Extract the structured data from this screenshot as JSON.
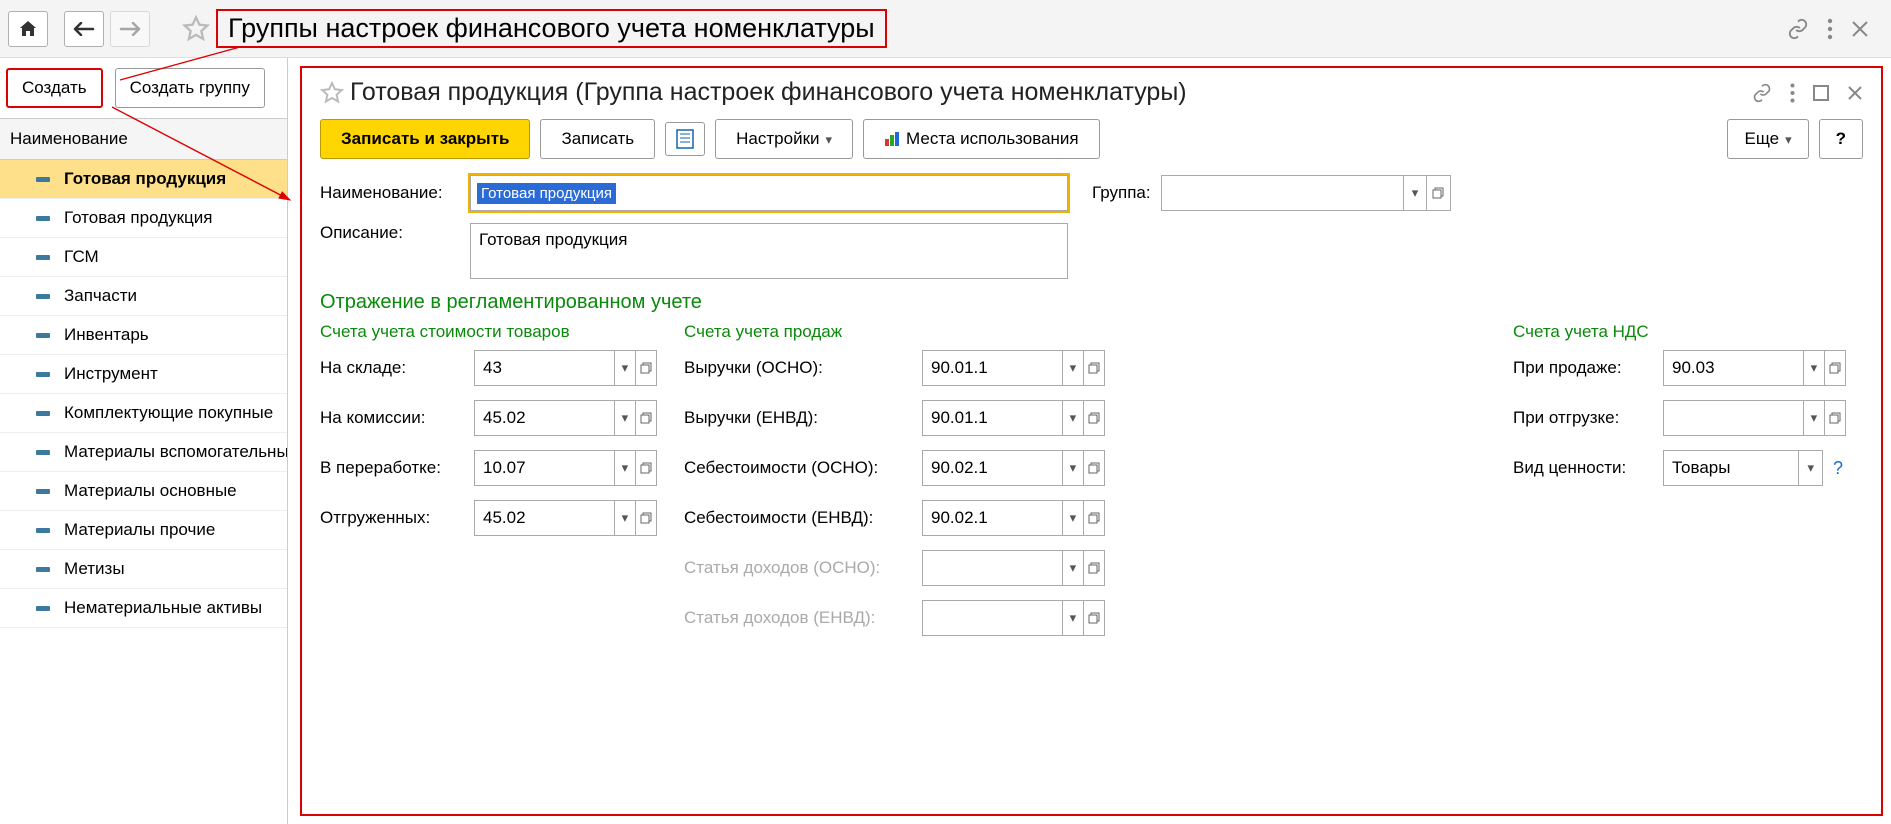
{
  "page": {
    "title": "Группы настроек финансового учета номенклатуры"
  },
  "left": {
    "create": "Создать",
    "createGroup": "Создать группу",
    "header": "Наименование",
    "items": [
      {
        "label": "Готовая продукция",
        "selected": true
      },
      {
        "label": "Готовая продукция"
      },
      {
        "label": "ГСМ"
      },
      {
        "label": "Запчасти"
      },
      {
        "label": "Инвентарь"
      },
      {
        "label": "Инструмент"
      },
      {
        "label": "Комплектующие покупные"
      },
      {
        "label": "Материалы вспомогательные"
      },
      {
        "label": "Материалы основные"
      },
      {
        "label": "Материалы прочие"
      },
      {
        "label": "Метизы"
      },
      {
        "label": "Нематериальные активы"
      }
    ]
  },
  "form": {
    "title": "Готовая продукция (Группа настроек финансового учета номенклатуры)",
    "toolbar": {
      "saveClose": "Записать и закрыть",
      "save": "Записать",
      "settings": "Настройки",
      "usages": "Места использования",
      "more": "Еще",
      "help": "?"
    },
    "fields": {
      "nameLabel": "Наименование:",
      "nameValue": "Готовая продукция",
      "groupLabel": "Группа:",
      "groupValue": "",
      "descLabel": "Описание:",
      "descValue": "Готовая продукция"
    },
    "section": "Отражение в регламентированном учете",
    "col1": {
      "header": "Счета учета стоимости товаров",
      "rows": [
        {
          "label": "На складе:",
          "value": "43"
        },
        {
          "label": "На комиссии:",
          "value": "45.02"
        },
        {
          "label": "В переработке:",
          "value": "10.07"
        },
        {
          "label": "Отгруженных:",
          "value": "45.02"
        }
      ]
    },
    "col2": {
      "header": "Счета учета продаж",
      "rows": [
        {
          "label": "Выручки (ОСНО):",
          "value": "90.01.1"
        },
        {
          "label": "Выручки (ЕНВД):",
          "value": "90.01.1"
        },
        {
          "label": "Себестоимости (ОСНО):",
          "value": "90.02.1"
        },
        {
          "label": "Себестоимости (ЕНВД):",
          "value": "90.02.1"
        },
        {
          "label": "Статья доходов (ОСНО):",
          "value": "",
          "grey": true
        },
        {
          "label": "Статья доходов (ЕНВД):",
          "value": "",
          "grey": true
        }
      ]
    },
    "col3": {
      "header": "Счета учета НДС",
      "rows": [
        {
          "label": "При продаже:",
          "value": "90.03"
        },
        {
          "label": "При отгрузке:",
          "value": ""
        },
        {
          "label": "Вид ценности:",
          "value": "Товары",
          "hasHelp": true
        }
      ]
    }
  }
}
